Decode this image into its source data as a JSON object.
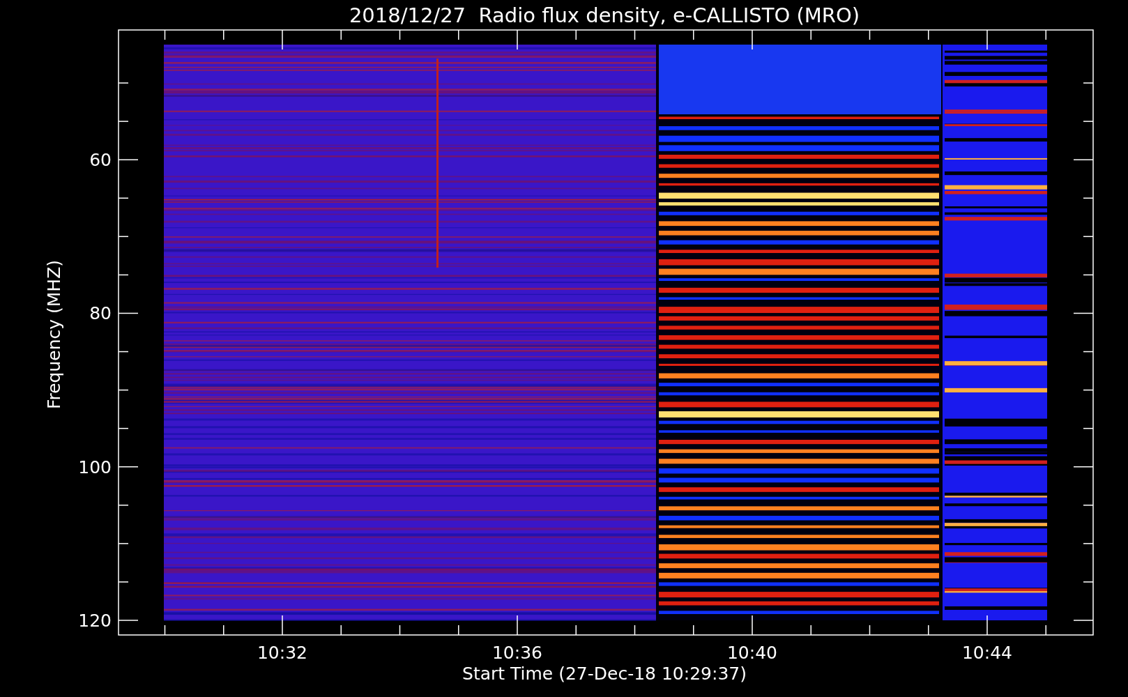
{
  "title": "2018/12/27  Radio flux density, e-CALLISTO (MRO)",
  "y_axis": {
    "label": "Frequency (MHZ)",
    "ticks": [
      "60",
      "80",
      "100",
      "120"
    ]
  },
  "x_axis": {
    "label": "Start Time (27-Dec-18 10:29:37)",
    "ticks": [
      "10:32",
      "10:36",
      "10:40",
      "10:44"
    ]
  }
}
